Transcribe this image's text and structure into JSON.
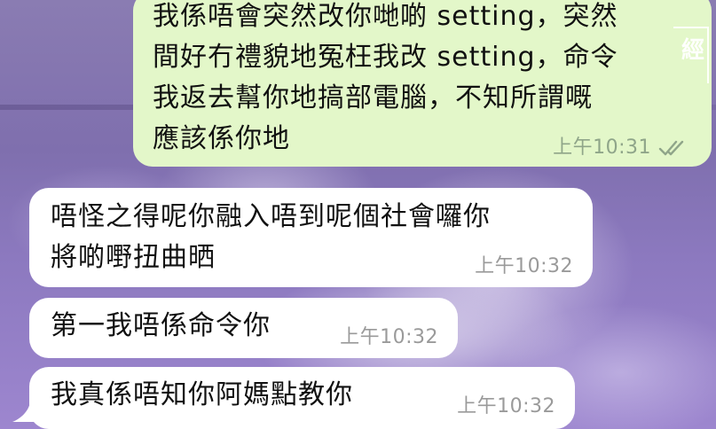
{
  "theme": {
    "outgoing_bubble_color": "#e3f7c9",
    "incoming_bubble_color": "#ffffff",
    "wallpaper_color": "#7d6aa6",
    "outgoing_time_color": "#8fa589",
    "incoming_time_color": "#9a9a9a"
  },
  "messages": [
    {
      "direction": "outgoing",
      "text": "我係唔會突然改你哋啲 setting，突然\n間好冇禮貌地冤枉我改 setting，命令\n我返去幫你地搞部電腦，不知所謂嘅\n應該係你地",
      "time": "上午10:31",
      "status_icon": "double-check-icon"
    },
    {
      "direction": "incoming",
      "text": "唔怪之得呢你融入唔到呢個社會囉你\n將啲嘢扭曲晒",
      "time": "上午10:32"
    },
    {
      "direction": "incoming",
      "text": "第一我唔係命令你",
      "time": "上午10:32"
    },
    {
      "direction": "incoming",
      "text": "我真係唔知你阿媽點教你",
      "time": "上午10:32"
    }
  ],
  "watermark": {
    "char": "經"
  }
}
